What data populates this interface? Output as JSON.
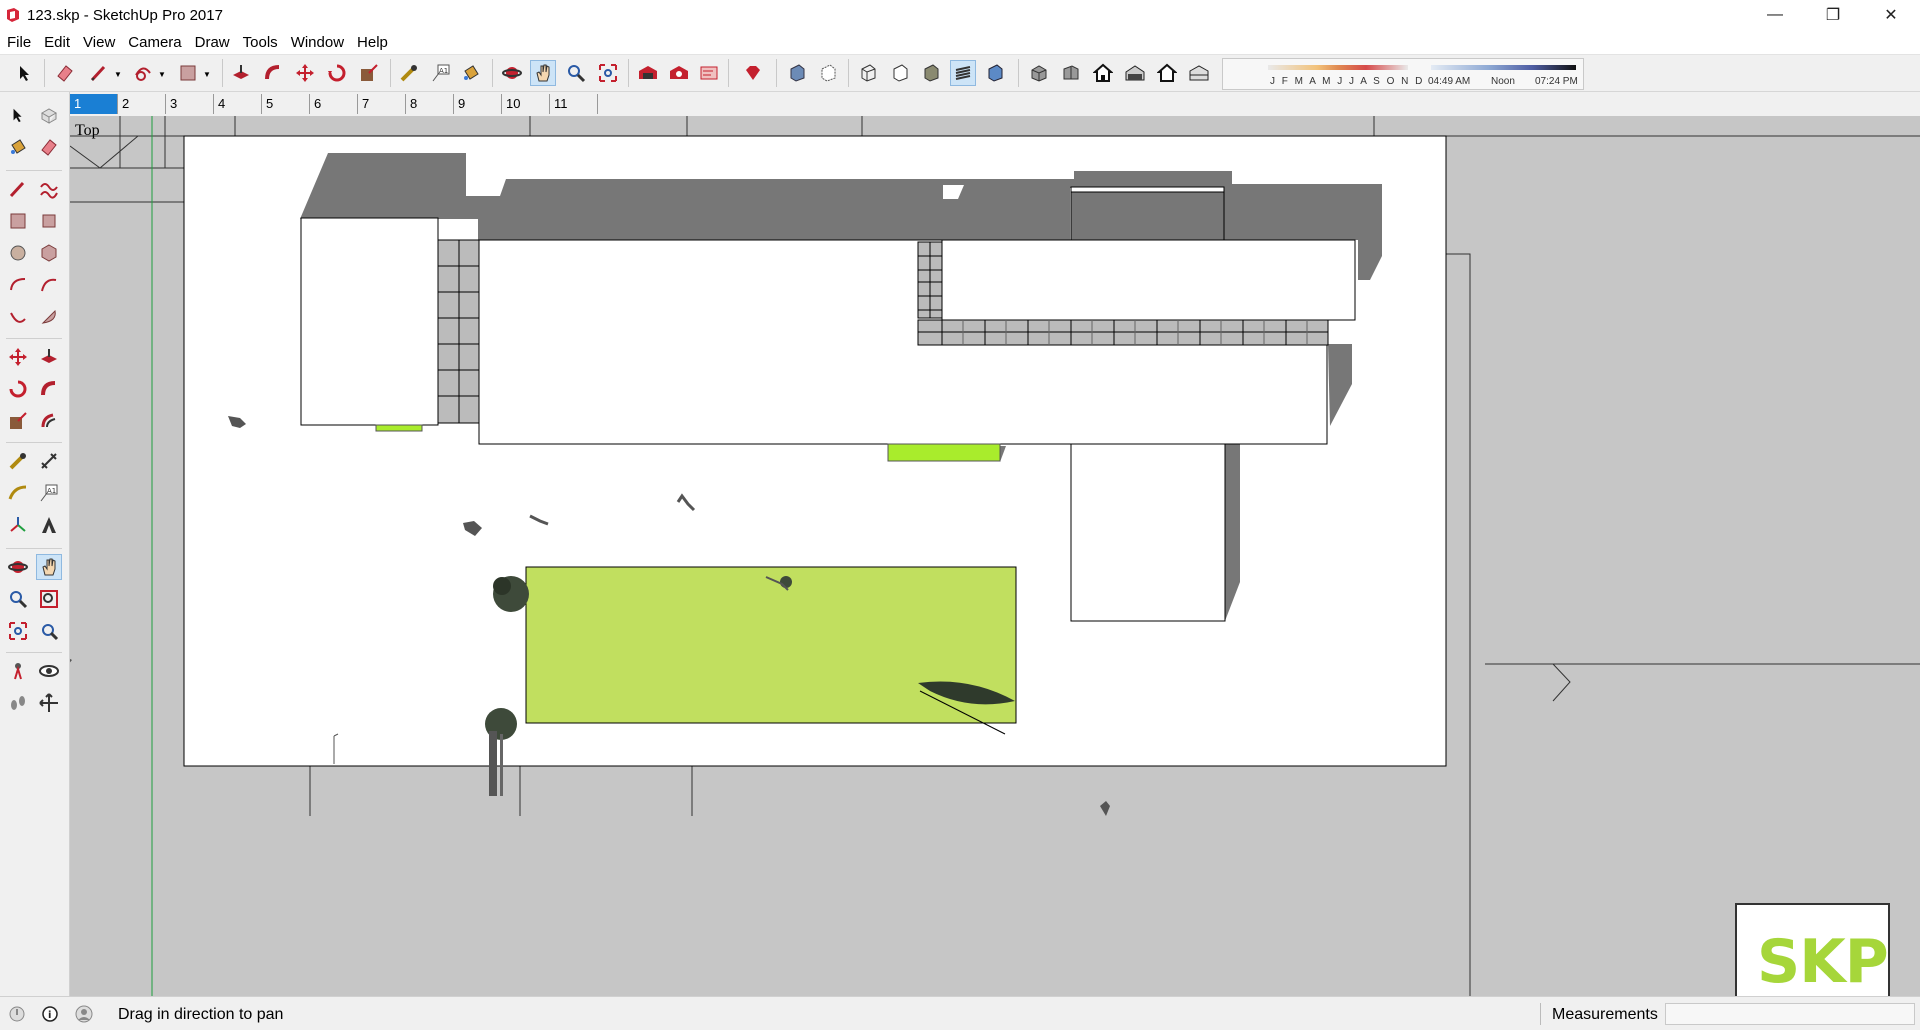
{
  "window": {
    "title": "123.skp - SketchUp Pro 2017",
    "minimize_glyph": "—",
    "restore_glyph": "❐",
    "close_glyph": "✕"
  },
  "menu": [
    "File",
    "Edit",
    "View",
    "Camera",
    "Draw",
    "Tools",
    "Window",
    "Help"
  ],
  "shadow": {
    "months": "J F M A M J J A S O N D",
    "time_start": "04:49 AM",
    "time_mid": "Noon",
    "time_end": "07:24 PM"
  },
  "scenes": {
    "tabs": [
      "1",
      "2",
      "3",
      "4",
      "5",
      "6",
      "7",
      "8",
      "9",
      "10",
      "11"
    ],
    "active_index": 0
  },
  "viewport": {
    "view_name": "Top",
    "colors": {
      "background": "#c6c6c6",
      "paper": "#ffffff",
      "shadow": "#777777",
      "lawn": "#c1df5f",
      "lawn_bright": "#a9ec2c",
      "outline": "#000000",
      "axis_green": "#1f9f3f"
    }
  },
  "toolbar_icons": [
    "select-icon",
    "eraser-icon",
    "line-icon",
    "shapes-icon",
    "paint-icon",
    "push-pull-icon",
    "follow-me-icon",
    "move-icon",
    "rotate-icon",
    "scale-icon",
    "tape-measure-icon",
    "text-icon",
    "paint-bucket-icon",
    "orbit-icon",
    "pan-icon",
    "zoom-icon",
    "zoom-extents-icon",
    "warehouse-icon",
    "extension-icon",
    "layout-icon",
    "ruby-icon",
    "xray-icon",
    "back-edges-icon",
    "wireframe-icon",
    "hidden-line-icon",
    "shaded-icon",
    "shaded-textures-icon",
    "monochrome-icon",
    "iso-view-icon",
    "top-view-icon",
    "front-view-icon",
    "right-view-icon",
    "back-view-icon",
    "left-view-icon",
    "shadows-toggle-icon"
  ],
  "logo": {
    "text": "SKP"
  },
  "status": {
    "message": "Drag in direction to pan",
    "measurements_label": "Measurements"
  }
}
